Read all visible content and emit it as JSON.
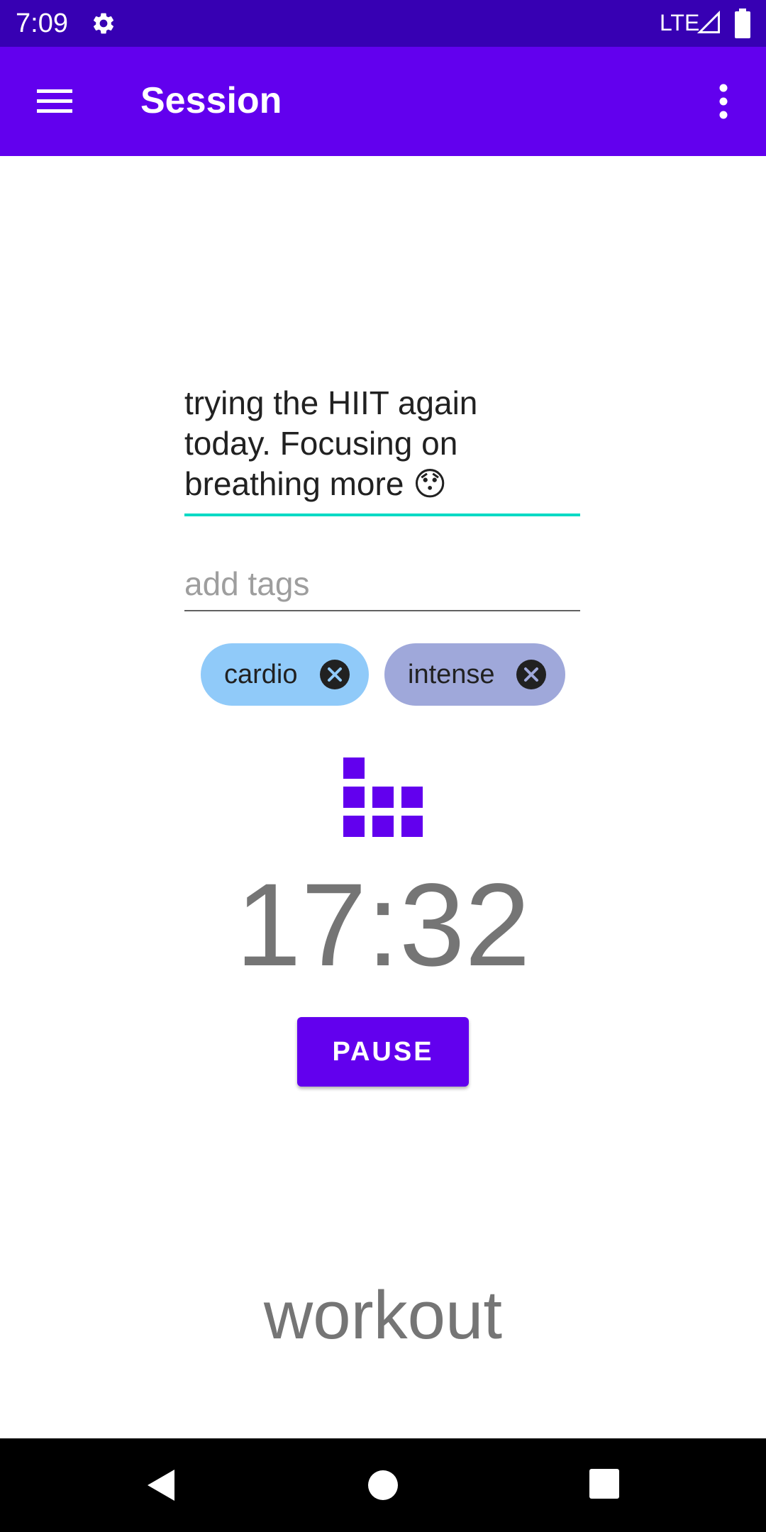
{
  "status_bar": {
    "time": "7:09",
    "network": "LTE",
    "settings_icon": "gear-icon",
    "signal_icon": "signal-icon",
    "battery_icon": "battery-icon"
  },
  "app_bar": {
    "title": "Session",
    "menu_icon": "hamburger-menu-icon",
    "overflow_icon": "more-vert-icon",
    "color": "#6200ee"
  },
  "notes": {
    "value": "trying the HIIT again\ntoday. Focusing on\nbreathing more 😯",
    "underline_color": "#03dac5"
  },
  "tags": {
    "placeholder": "add tags",
    "value": "",
    "chips": [
      {
        "label": "cardio",
        "color": "#90caf9"
      },
      {
        "label": "intense",
        "color": "#9fa8da"
      }
    ]
  },
  "session": {
    "icon": "equalizer-icon",
    "timer": "17:32",
    "pause_label": "PAUSE",
    "activity": "workout"
  },
  "nav_bar": {
    "back_icon": "back-icon",
    "home_icon": "home-icon",
    "recents_icon": "recents-icon"
  },
  "colors": {
    "primary": "#6200ee",
    "primary_dark": "#3700b3",
    "accent": "#03dac5"
  }
}
